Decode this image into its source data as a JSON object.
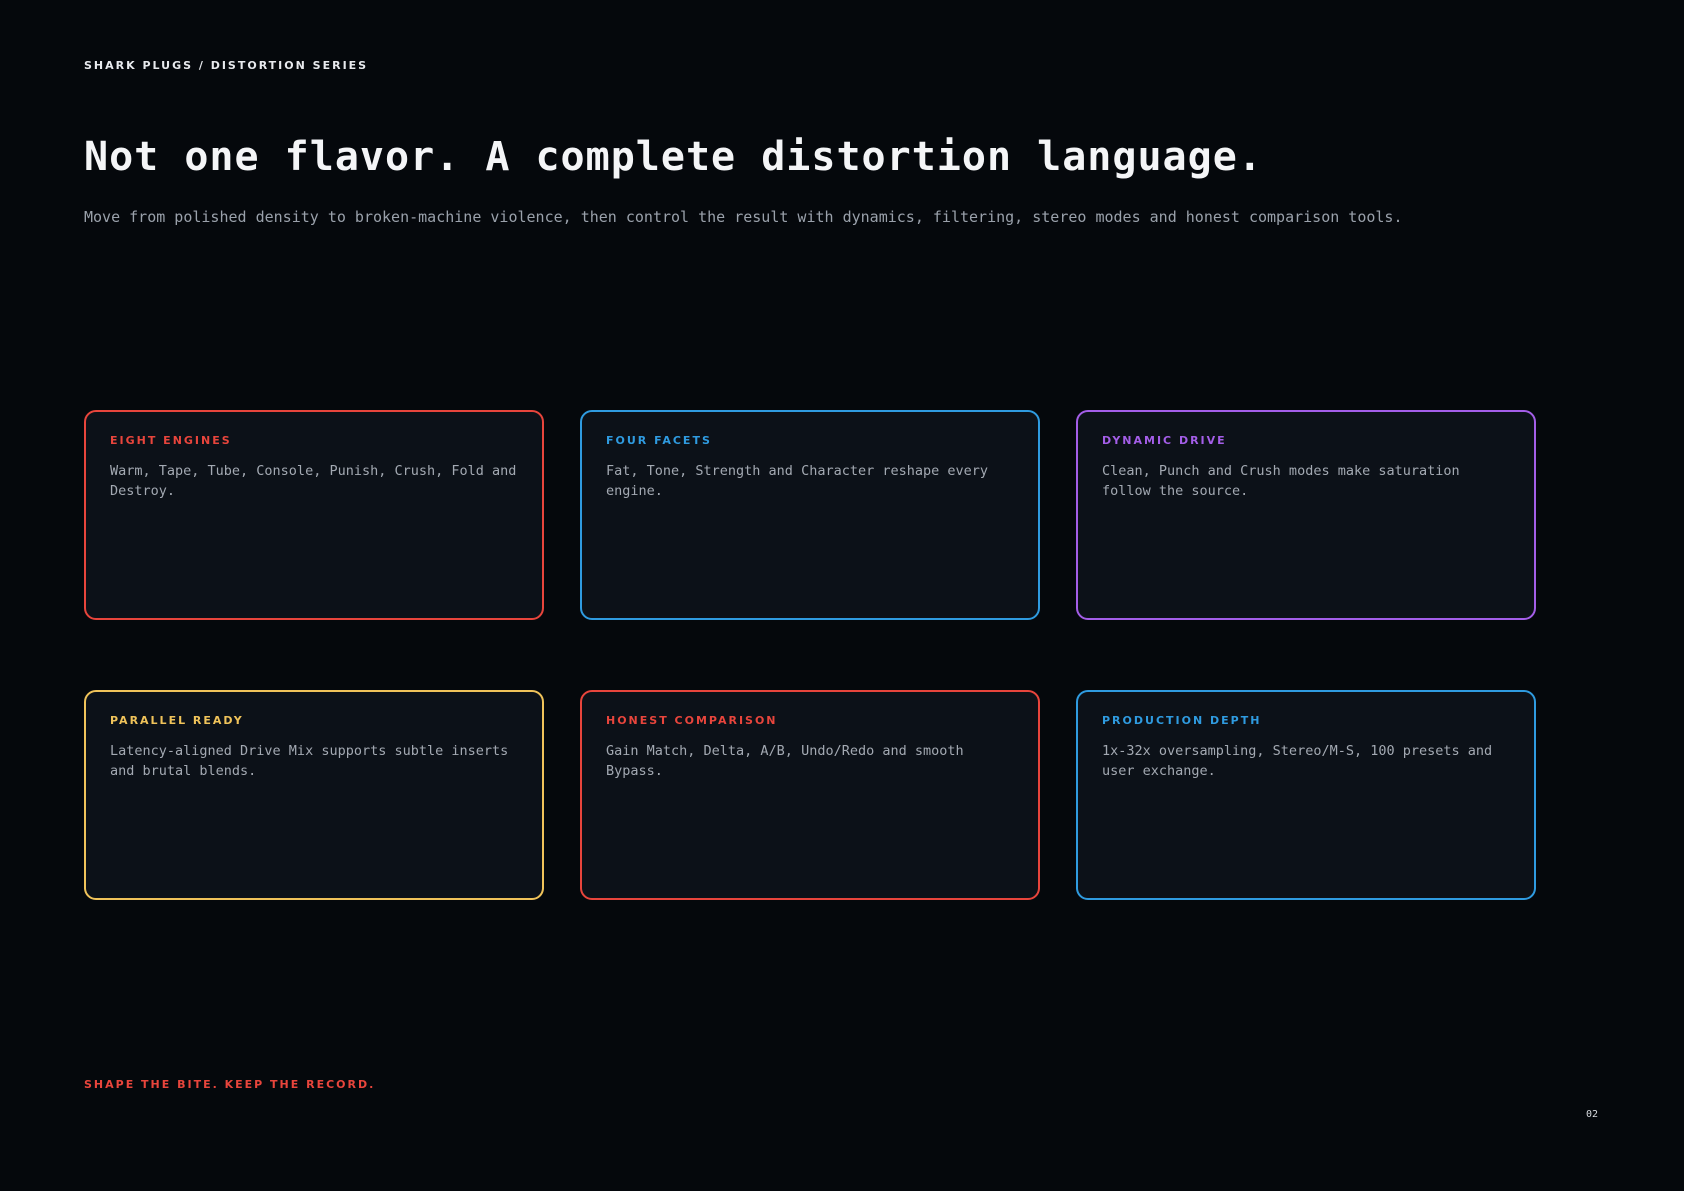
{
  "header": {
    "eyebrow": "SHARK PLUGS / DISTORTION SERIES",
    "title": "Not one flavor. A complete distortion language.",
    "subtitle": "Move from polished density to broken-machine violence, then control the result with dynamics, filtering, stereo modes and honest comparison tools."
  },
  "cards": [
    {
      "title": "EIGHT ENGINES",
      "body": "Warm, Tape, Tube, Console, Punish, Crush, Fold and Destroy.",
      "color": "#e8453c"
    },
    {
      "title": "FOUR FACETS",
      "body": "Fat, Tone, Strength and Character reshape every engine.",
      "color": "#2f9be0"
    },
    {
      "title": "DYNAMIC DRIVE",
      "body": "Clean, Punch and Crush modes make saturation follow the source.",
      "color": "#a45ee8"
    },
    {
      "title": "PARALLEL READY",
      "body": "Latency-aligned Drive Mix supports subtle inserts and brutal blends.",
      "color": "#f0c35a"
    },
    {
      "title": "HONEST COMPARISON",
      "body": "Gain Match, Delta, A/B, Undo/Redo and smooth Bypass.",
      "color": "#e8453c"
    },
    {
      "title": "PRODUCTION DEPTH",
      "body": "1x-32x oversampling, Stereo/M-S, 100 presets and user exchange.",
      "color": "#2f9be0"
    }
  ],
  "footer": {
    "tagline": "SHAPE THE BITE. KEEP THE RECORD.",
    "page_number": "02"
  }
}
